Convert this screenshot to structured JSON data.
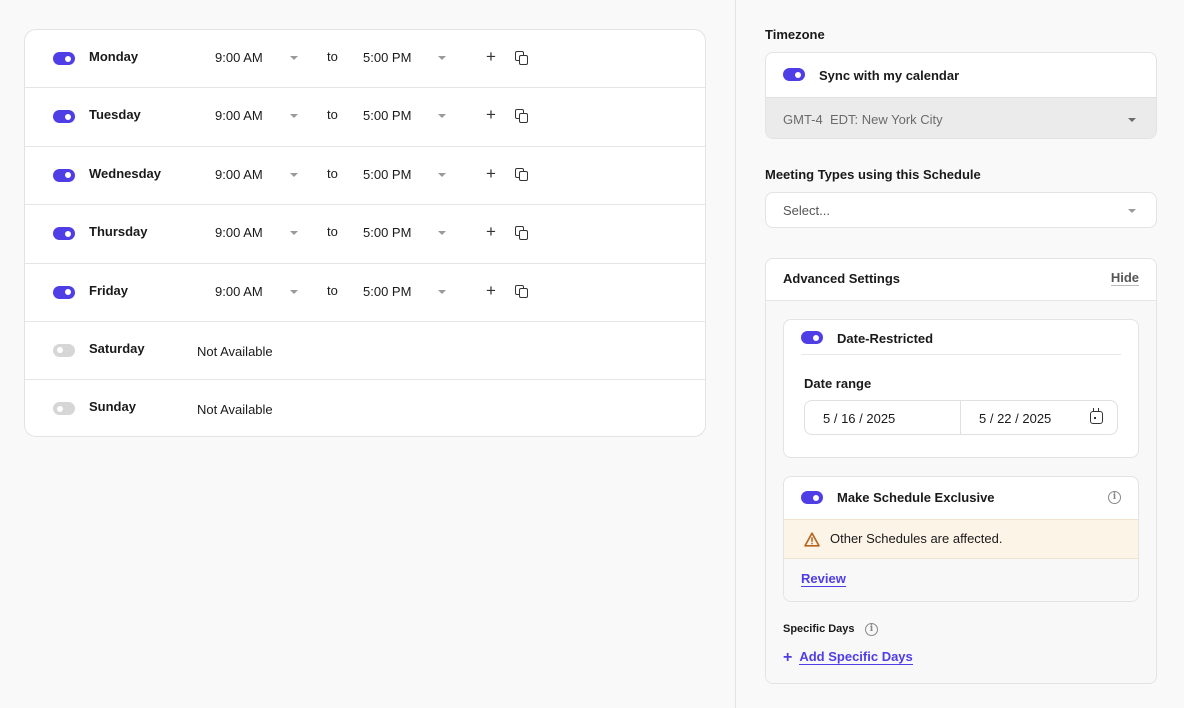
{
  "schedule": {
    "to_label": "to",
    "days": [
      {
        "name": "Monday",
        "enabled": true,
        "start": "9:00 AM",
        "end": "5:00 PM"
      },
      {
        "name": "Tuesday",
        "enabled": true,
        "start": "9:00 AM",
        "end": "5:00 PM"
      },
      {
        "name": "Wednesday",
        "enabled": true,
        "start": "9:00 AM",
        "end": "5:00 PM"
      },
      {
        "name": "Thursday",
        "enabled": true,
        "start": "9:00 AM",
        "end": "5:00 PM"
      },
      {
        "name": "Friday",
        "enabled": true,
        "start": "9:00 AM",
        "end": "5:00 PM"
      },
      {
        "name": "Saturday",
        "enabled": false,
        "status": "Not Available"
      },
      {
        "name": "Sunday",
        "enabled": false,
        "status": "Not Available"
      }
    ]
  },
  "timezone": {
    "label": "Timezone",
    "sync_label": "Sync with my calendar",
    "sync_enabled": true,
    "value": "GMT-4  EDT: New York City"
  },
  "meeting_types": {
    "label": "Meeting Types using this Schedule",
    "placeholder": "Select..."
  },
  "advanced": {
    "title": "Advanced Settings",
    "hide_label": "Hide",
    "date_restricted": {
      "label": "Date-Restricted",
      "enabled": true,
      "range_label": "Date range",
      "start": "5 / 16 / 2025",
      "end": "5 / 22 / 2025"
    },
    "exclusive": {
      "label": "Make Schedule Exclusive",
      "enabled": true,
      "warning": "Other Schedules are affected.",
      "review_label": "Review"
    },
    "specific_days": {
      "label": "Specific Days",
      "add_label": "Add Specific Days"
    }
  },
  "colors": {
    "accent": "#4f3de6",
    "toggle_off": "#d6d6d6",
    "warning_bg": "#fdf4e8",
    "warning_icon": "#b5651d"
  }
}
